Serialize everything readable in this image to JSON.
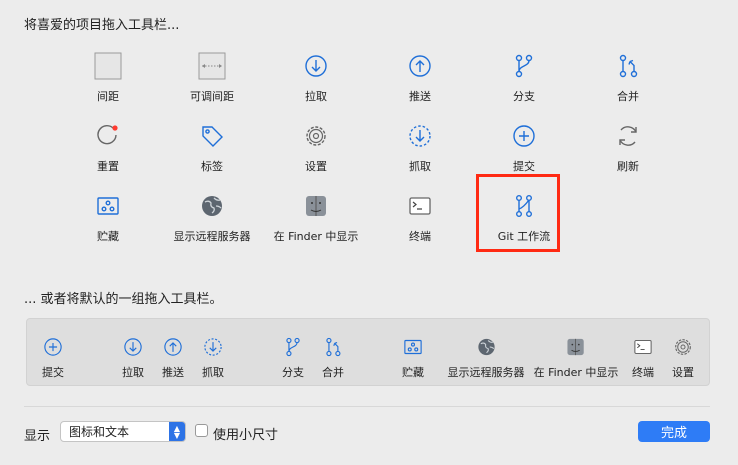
{
  "header": {
    "title": "将喜爱的项目拖入工具栏..."
  },
  "palette": [
    {
      "label": "间距",
      "icon": "space-icon"
    },
    {
      "label": "可调间距",
      "icon": "flexible-space-icon"
    },
    {
      "label": "拉取",
      "icon": "pull-icon"
    },
    {
      "label": "推送",
      "icon": "push-icon"
    },
    {
      "label": "分支",
      "icon": "branch-icon"
    },
    {
      "label": "合并",
      "icon": "merge-icon"
    },
    {
      "label": "重置",
      "icon": "reset-icon"
    },
    {
      "label": "标签",
      "icon": "tag-icon"
    },
    {
      "label": "设置",
      "icon": "gear-icon"
    },
    {
      "label": "抓取",
      "icon": "fetch-icon"
    },
    {
      "label": "提交",
      "icon": "commit-icon"
    },
    {
      "label": "刷新",
      "icon": "refresh-icon"
    },
    {
      "label": "贮藏",
      "icon": "stash-icon"
    },
    {
      "label": "显示远程服务器",
      "icon": "globe-icon"
    },
    {
      "label": "在 Finder 中显示",
      "icon": "finder-icon"
    },
    {
      "label": "终端",
      "icon": "terminal-icon"
    },
    {
      "label": "Git 工作流",
      "icon": "git-flow-icon"
    }
  ],
  "default_section": {
    "title": "... 或者将默认的一组拖入工具栏。",
    "items": [
      {
        "label": "提交",
        "icon": "commit-icon"
      },
      {
        "label": "拉取",
        "icon": "pull-icon"
      },
      {
        "label": "推送",
        "icon": "push-icon"
      },
      {
        "label": "抓取",
        "icon": "fetch-icon"
      },
      {
        "label": "分支",
        "icon": "branch-icon"
      },
      {
        "label": "合并",
        "icon": "merge-icon"
      },
      {
        "label": "贮藏",
        "icon": "stash-icon"
      },
      {
        "label": "显示远程服务器",
        "icon": "globe-icon"
      },
      {
        "label": "在 Finder 中显示",
        "icon": "finder-icon"
      },
      {
        "label": "终端",
        "icon": "terminal-icon"
      },
      {
        "label": "设置",
        "icon": "gear-icon"
      }
    ]
  },
  "footer": {
    "show_label": "显示",
    "display_select": "图标和文本",
    "small_size_label": "使用小尺寸",
    "small_size_checked": false,
    "done_label": "完成"
  },
  "colors": {
    "accent": "#1f6fd8",
    "highlight": "#ff2a13",
    "button": "#2e7cf6"
  }
}
